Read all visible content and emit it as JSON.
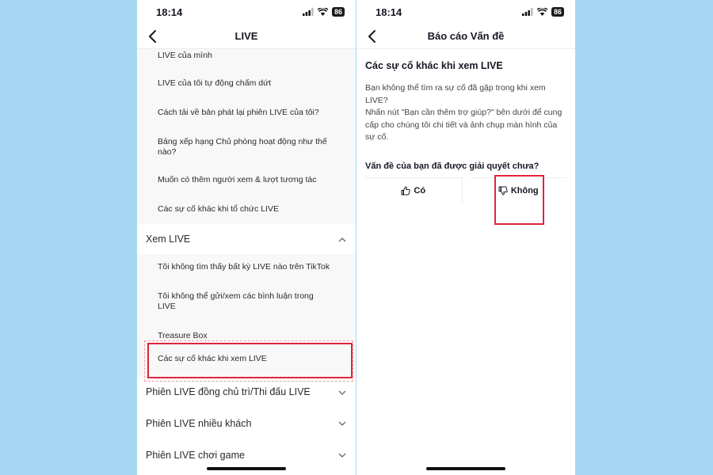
{
  "left": {
    "status_time": "18:14",
    "battery": "86",
    "nav_title": "LIVE",
    "group1": [
      "LIVE của mình",
      "LIVE của tôi tự động chấm dứt",
      "Cách tải về bản phát lại phiên LIVE của tôi?",
      "Bảng xếp hạng Chủ phòng hoạt động như thế nào?",
      "Muốn có thêm người xem & lượt tương tác",
      "Các sự cố khác khi tổ chức LIVE"
    ],
    "section_watch": "Xem LIVE",
    "group2": [
      "Tôi không tìm thấy bất kỳ LIVE nào trên TikTok",
      "Tôi không thể gửi/xem các bình luận trong LIVE",
      "Treasure Box",
      "Các sự cố khác khi xem LIVE"
    ],
    "sections": [
      "Phiên LIVE đồng chủ trì/Thi đấu LIVE",
      "Phiên LIVE nhiều khách",
      "Phiên LIVE chơi game"
    ]
  },
  "right": {
    "status_time": "18:14",
    "battery": "86",
    "nav_title": "Báo cáo Vấn đề",
    "article_title": "Các sự cố khác khi xem LIVE",
    "paragraph1": "Bạn không thể tìm ra sự cố đã gặp trong khi xem LIVE?",
    "paragraph2": "Nhấn nút \"Bạn cần thêm trợ giúp?\" bên dưới để cung cấp cho chúng tôi chi tiết và ảnh chụp màn hình của sự cố.",
    "question": "Vấn đề của bạn đã được giải quyết chưa?",
    "yes_label": "Có",
    "no_label": "Không"
  },
  "colors": {
    "background": "#a7d8f3",
    "highlight": "#e0253a"
  }
}
